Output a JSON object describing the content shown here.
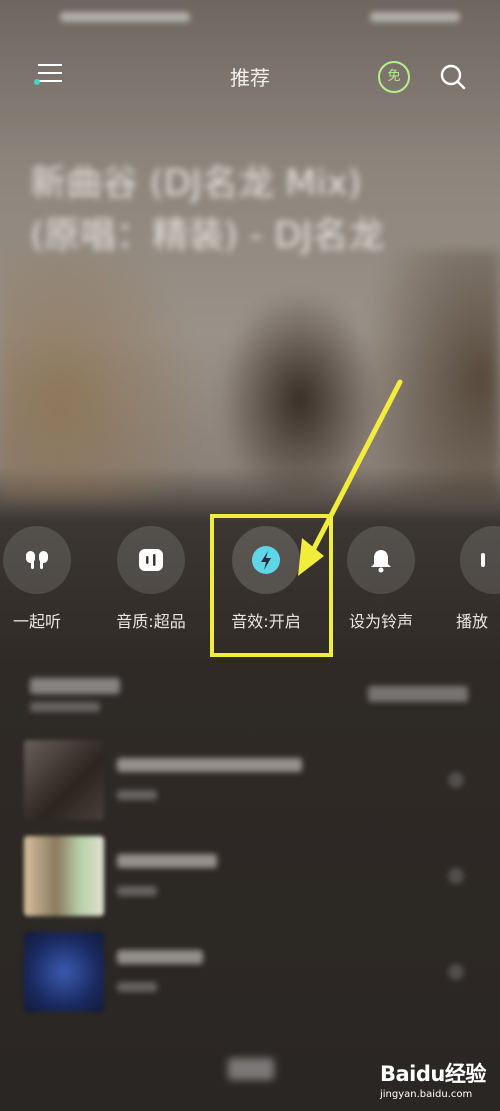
{
  "header": {
    "title": "推荐",
    "vip_label": "免"
  },
  "song": {
    "title_line1": "新曲谷 (DJ名龙 Mix)",
    "title_line2": "(原唱：精装) - DJ名龙"
  },
  "actions": [
    {
      "label": "一起听",
      "icon": "earbuds-icon"
    },
    {
      "label": "音质:超品",
      "icon": "audio-quality-icon"
    },
    {
      "label": "音效:开启",
      "icon": "lightning-icon"
    },
    {
      "label": "设为铃声",
      "icon": "bell-icon"
    },
    {
      "label": "播放",
      "icon": "play-icon"
    }
  ],
  "watermark": {
    "logo_prefix": "Bai",
    "logo_paw": "du",
    "logo_suffix": "经验",
    "domain": "jingyan.baidu.com"
  },
  "colors": {
    "highlight": "#f2ec3a",
    "accent": "#5fd6e7",
    "vip": "#b6f08a"
  }
}
